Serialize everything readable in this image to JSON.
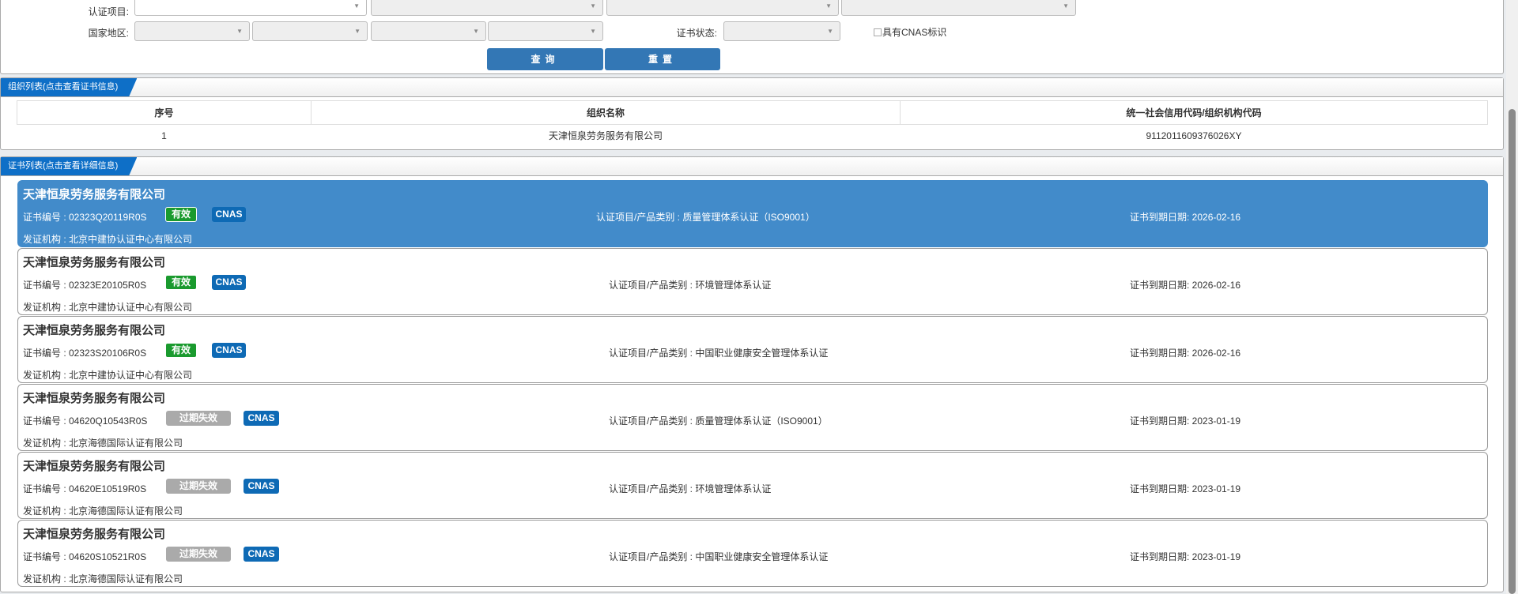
{
  "filter": {
    "cert_item_label": "认证项目:",
    "region_label": "国家地区:",
    "status_label": "证书状态:",
    "cnas_checkbox_label": "具有CNAS标识",
    "cnas_checked": false,
    "query_button": "查询",
    "reset_button": "重置"
  },
  "org_list": {
    "title": "组织列表(点击查看证书信息)",
    "columns": [
      "序号",
      "组织名称",
      "统一社会信用代码/组织机构代码"
    ],
    "rows": [
      [
        "1",
        "天津恒泉劳务服务有限公司",
        "9112011609376026XY"
      ]
    ]
  },
  "cert_list": {
    "title": "证书列表(点击查看详细信息)",
    "items": [
      {
        "company": "天津恒泉劳务服务有限公司",
        "cert_no": "证书编号 : 02323Q20119R0S",
        "status": "有效",
        "status_type": "valid",
        "cnas": "CNAS",
        "category": "认证项目/产品类别 : 质量管理体系认证（ISO9001）",
        "expiry": "证书到期日期: 2026-02-16",
        "issuer": "发证机构 : 北京中建协认证中心有限公司",
        "selected": true
      },
      {
        "company": "天津恒泉劳务服务有限公司",
        "cert_no": "证书编号 : 02323E20105R0S",
        "status": "有效",
        "status_type": "valid",
        "cnas": "CNAS",
        "category": "认证项目/产品类别 : 环境管理体系认证",
        "expiry": "证书到期日期: 2026-02-16",
        "issuer": "发证机构 : 北京中建协认证中心有限公司",
        "selected": false
      },
      {
        "company": "天津恒泉劳务服务有限公司",
        "cert_no": "证书编号 : 02323S20106R0S",
        "status": "有效",
        "status_type": "valid",
        "cnas": "CNAS",
        "category": "认证项目/产品类别 : 中国职业健康安全管理体系认证",
        "expiry": "证书到期日期: 2026-02-16",
        "issuer": "发证机构 : 北京中建协认证中心有限公司",
        "selected": false
      },
      {
        "company": "天津恒泉劳务服务有限公司",
        "cert_no": "证书编号 : 04620Q10543R0S",
        "status": "过期失效",
        "status_type": "expired",
        "cnas": "CNAS",
        "category": "认证项目/产品类别 : 质量管理体系认证（ISO9001）",
        "expiry": "证书到期日期: 2023-01-19",
        "issuer": "发证机构 : 北京海德国际认证有限公司",
        "selected": false
      },
      {
        "company": "天津恒泉劳务服务有限公司",
        "cert_no": "证书编号 : 04620E10519R0S",
        "status": "过期失效",
        "status_type": "expired",
        "cnas": "CNAS",
        "category": "认证项目/产品类别 : 环境管理体系认证",
        "expiry": "证书到期日期: 2023-01-19",
        "issuer": "发证机构 : 北京海德国际认证有限公司",
        "selected": false
      },
      {
        "company": "天津恒泉劳务服务有限公司",
        "cert_no": "证书编号 : 04620S10521R0S",
        "status": "过期失效",
        "status_type": "expired",
        "cnas": "CNAS",
        "category": "认证项目/产品类别 : 中国职业健康安全管理体系认证",
        "expiry": "证书到期日期: 2023-01-19",
        "issuer": "发证机构 : 北京海德国际认证有限公司",
        "selected": false
      }
    ]
  }
}
